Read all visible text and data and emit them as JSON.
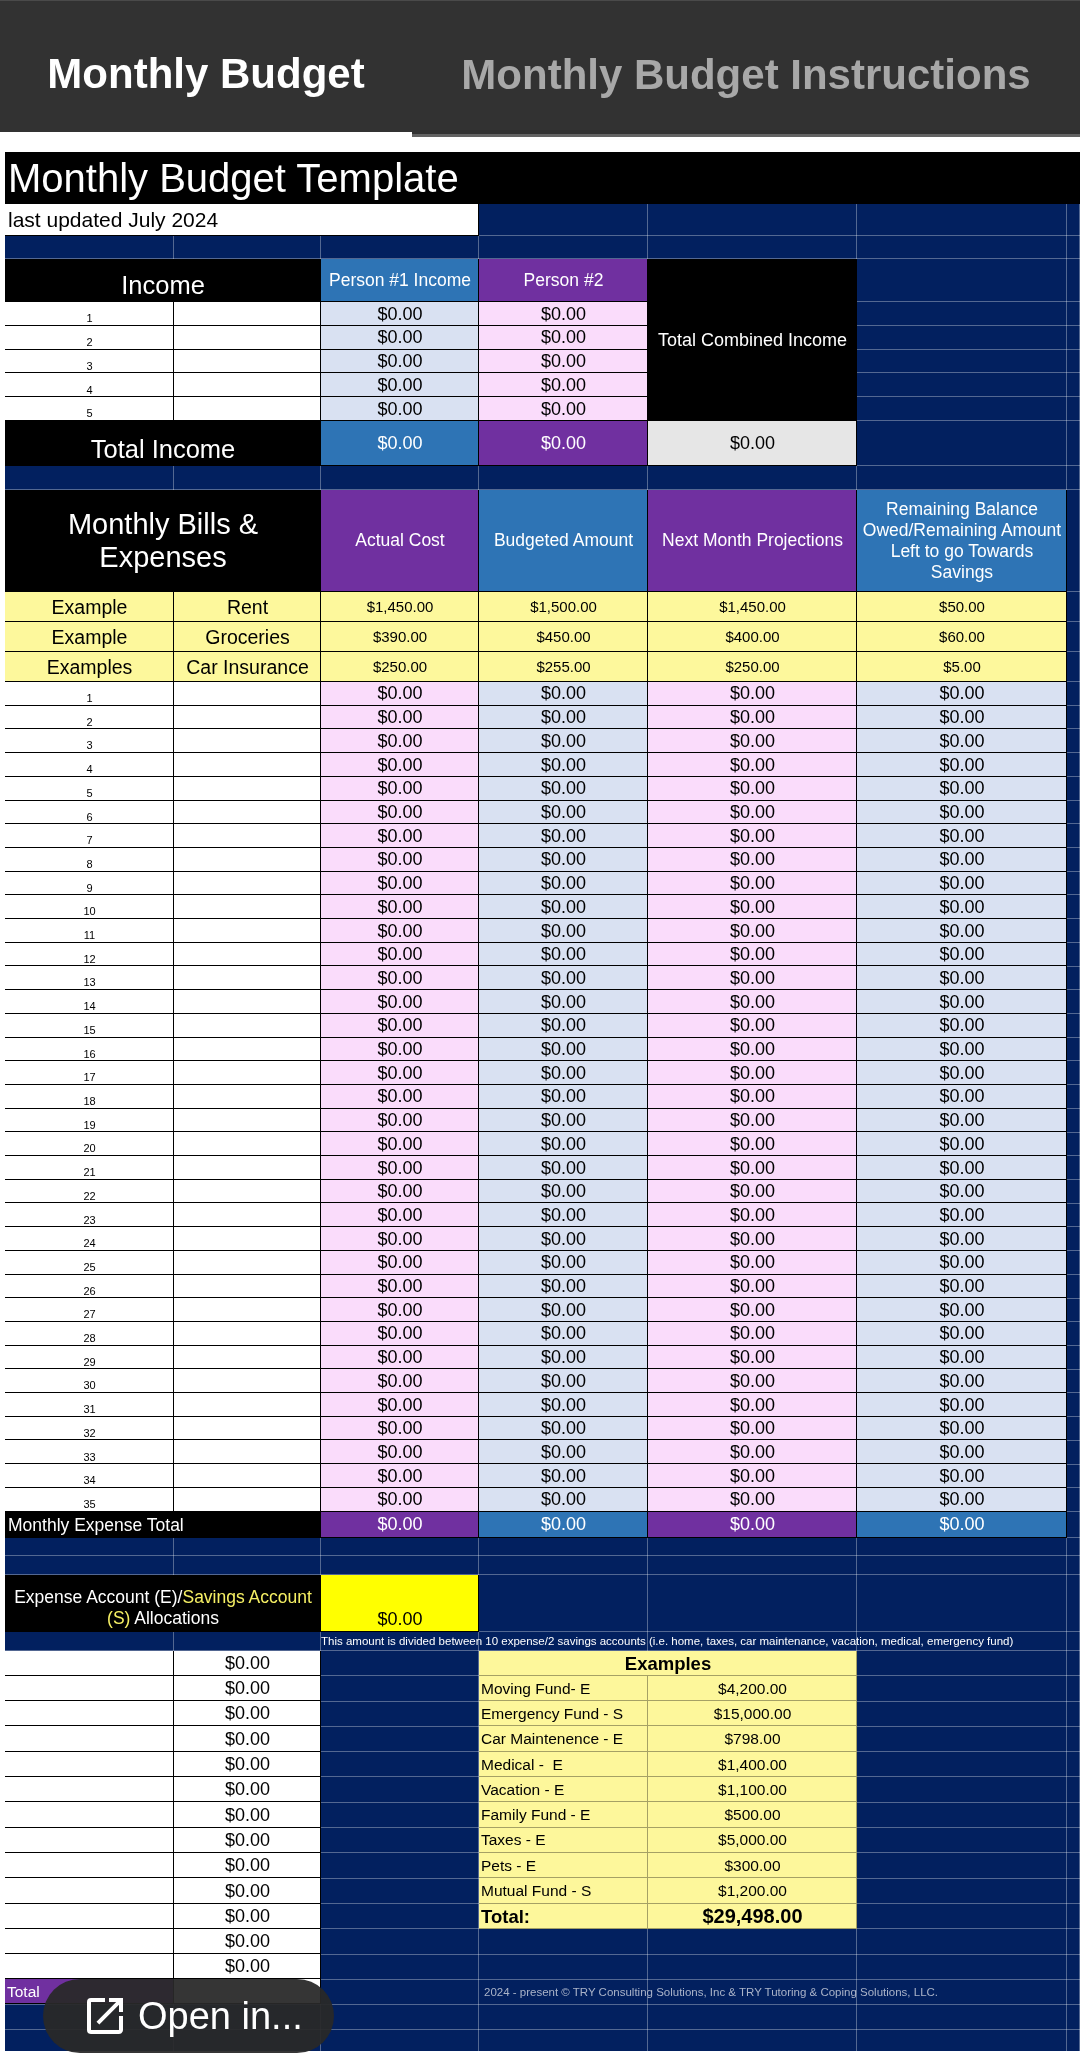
{
  "tabs": [
    {
      "label": "Monthly Budget",
      "selected": true
    },
    {
      "label": "Monthly Budget Instructions",
      "selected": false
    }
  ],
  "sheet": {
    "title": "Monthly Budget Template",
    "subtitle": "last updated July 2024",
    "income": {
      "heading": "Income",
      "columns": [
        "Person #1 Income",
        "Person #2"
      ],
      "combined_label": "Total Combined Income",
      "rows": [
        {
          "number": "1",
          "values": [
            "$0.00",
            "$0.00"
          ]
        },
        {
          "number": "2",
          "values": [
            "$0.00",
            "$0.00"
          ]
        },
        {
          "number": "3",
          "values": [
            "$0.00",
            "$0.00"
          ]
        },
        {
          "number": "4",
          "values": [
            "$0.00",
            "$0.00"
          ]
        },
        {
          "number": "5",
          "values": [
            "$0.00",
            "$0.00"
          ]
        }
      ],
      "total": {
        "label": "Total Income",
        "values": [
          "$0.00",
          "$0.00"
        ],
        "combined": "$0.00"
      }
    },
    "bills": {
      "heading": "Monthly Bills & Expenses",
      "columns": [
        "Actual Cost",
        "Budgeted Amount",
        "Next Month Projections",
        "Remaining Balance Owed/Remaining Amount Left to go Towards Savings"
      ],
      "examples": [
        {
          "label": "Example",
          "item": "Rent",
          "values": [
            "$1,450.00",
            "$1,500.00",
            "$1,450.00",
            "$50.00"
          ]
        },
        {
          "label": "Example",
          "item": "Groceries",
          "values": [
            "$390.00",
            "$450.00",
            "$400.00",
            "$60.00"
          ]
        },
        {
          "label": "Examples",
          "item": "Car Insurance",
          "values": [
            "$250.00",
            "$255.00",
            "$250.00",
            "$5.00"
          ]
        }
      ],
      "rows": [
        {
          "number": "1",
          "values": [
            "$0.00",
            "$0.00",
            "$0.00",
            "$0.00"
          ]
        },
        {
          "number": "2",
          "values": [
            "$0.00",
            "$0.00",
            "$0.00",
            "$0.00"
          ]
        },
        {
          "number": "3",
          "values": [
            "$0.00",
            "$0.00",
            "$0.00",
            "$0.00"
          ]
        },
        {
          "number": "4",
          "values": [
            "$0.00",
            "$0.00",
            "$0.00",
            "$0.00"
          ]
        },
        {
          "number": "5",
          "values": [
            "$0.00",
            "$0.00",
            "$0.00",
            "$0.00"
          ]
        },
        {
          "number": "6",
          "values": [
            "$0.00",
            "$0.00",
            "$0.00",
            "$0.00"
          ]
        },
        {
          "number": "7",
          "values": [
            "$0.00",
            "$0.00",
            "$0.00",
            "$0.00"
          ]
        },
        {
          "number": "8",
          "values": [
            "$0.00",
            "$0.00",
            "$0.00",
            "$0.00"
          ]
        },
        {
          "number": "9",
          "values": [
            "$0.00",
            "$0.00",
            "$0.00",
            "$0.00"
          ]
        },
        {
          "number": "10",
          "values": [
            "$0.00",
            "$0.00",
            "$0.00",
            "$0.00"
          ]
        },
        {
          "number": "11",
          "values": [
            "$0.00",
            "$0.00",
            "$0.00",
            "$0.00"
          ]
        },
        {
          "number": "12",
          "values": [
            "$0.00",
            "$0.00",
            "$0.00",
            "$0.00"
          ]
        },
        {
          "number": "13",
          "values": [
            "$0.00",
            "$0.00",
            "$0.00",
            "$0.00"
          ]
        },
        {
          "number": "14",
          "values": [
            "$0.00",
            "$0.00",
            "$0.00",
            "$0.00"
          ]
        },
        {
          "number": "15",
          "values": [
            "$0.00",
            "$0.00",
            "$0.00",
            "$0.00"
          ]
        },
        {
          "number": "16",
          "values": [
            "$0.00",
            "$0.00",
            "$0.00",
            "$0.00"
          ]
        },
        {
          "number": "17",
          "values": [
            "$0.00",
            "$0.00",
            "$0.00",
            "$0.00"
          ]
        },
        {
          "number": "18",
          "values": [
            "$0.00",
            "$0.00",
            "$0.00",
            "$0.00"
          ]
        },
        {
          "number": "19",
          "values": [
            "$0.00",
            "$0.00",
            "$0.00",
            "$0.00"
          ]
        },
        {
          "number": "20",
          "values": [
            "$0.00",
            "$0.00",
            "$0.00",
            "$0.00"
          ]
        },
        {
          "number": "21",
          "values": [
            "$0.00",
            "$0.00",
            "$0.00",
            "$0.00"
          ]
        },
        {
          "number": "22",
          "values": [
            "$0.00",
            "$0.00",
            "$0.00",
            "$0.00"
          ]
        },
        {
          "number": "23",
          "values": [
            "$0.00",
            "$0.00",
            "$0.00",
            "$0.00"
          ]
        },
        {
          "number": "24",
          "values": [
            "$0.00",
            "$0.00",
            "$0.00",
            "$0.00"
          ]
        },
        {
          "number": "25",
          "values": [
            "$0.00",
            "$0.00",
            "$0.00",
            "$0.00"
          ]
        },
        {
          "number": "26",
          "values": [
            "$0.00",
            "$0.00",
            "$0.00",
            "$0.00"
          ]
        },
        {
          "number": "27",
          "values": [
            "$0.00",
            "$0.00",
            "$0.00",
            "$0.00"
          ]
        },
        {
          "number": "28",
          "values": [
            "$0.00",
            "$0.00",
            "$0.00",
            "$0.00"
          ]
        },
        {
          "number": "29",
          "values": [
            "$0.00",
            "$0.00",
            "$0.00",
            "$0.00"
          ]
        },
        {
          "number": "30",
          "values": [
            "$0.00",
            "$0.00",
            "$0.00",
            "$0.00"
          ]
        },
        {
          "number": "31",
          "values": [
            "$0.00",
            "$0.00",
            "$0.00",
            "$0.00"
          ]
        },
        {
          "number": "32",
          "values": [
            "$0.00",
            "$0.00",
            "$0.00",
            "$0.00"
          ]
        },
        {
          "number": "33",
          "values": [
            "$0.00",
            "$0.00",
            "$0.00",
            "$0.00"
          ]
        },
        {
          "number": "34",
          "values": [
            "$0.00",
            "$0.00",
            "$0.00",
            "$0.00"
          ]
        },
        {
          "number": "35",
          "values": [
            "$0.00",
            "$0.00",
            "$0.00",
            "$0.00"
          ]
        }
      ],
      "total": {
        "label": "Monthly Expense Total",
        "values": [
          "$0.00",
          "$0.00",
          "$0.00",
          "$0.00"
        ]
      }
    },
    "allocations": {
      "label": [
        {
          "text": "Expense Account (E)/",
          "highlight": false
        },
        {
          "text": "Savings Account (S)",
          "highlight": true
        },
        {
          "text": " Allocations",
          "highlight": false
        }
      ],
      "amount": "$0.00",
      "note": "This amount is divided between 10 expense/2 savings accounts (i.e. home, taxes, car maintenance, vacation, medical, emergency fund)",
      "values": [
        "$0.00",
        "$0.00",
        "$0.00",
        "$0.00",
        "$0.00",
        "$0.00",
        "$0.00",
        "$0.00",
        "$0.00",
        "$0.00",
        "$0.00",
        "$0.00",
        "$0.00"
      ],
      "total": {
        "label": "Total"
      }
    },
    "examples": {
      "heading": "Examples",
      "items": [
        {
          "label": "Moving Fund- E",
          "amount": "$4,200.00"
        },
        {
          "label": "Emergency Fund - S",
          "amount": "$15,000.00"
        },
        {
          "label": "Car Maintenence - E",
          "amount": "$798.00"
        },
        {
          "label": "Medical -  E",
          "amount": "$1,400.00"
        },
        {
          "label": "Vacation - E",
          "amount": "$1,100.00"
        },
        {
          "label": "Family Fund - E",
          "amount": "$500.00"
        },
        {
          "label": "Taxes - E",
          "amount": "$5,000.00"
        },
        {
          "label": "Pets - E",
          "amount": "$300.00"
        },
        {
          "label": "Mutual Fund - S",
          "amount": "$1,200.00"
        }
      ],
      "total": {
        "label": "Total:",
        "amount": "$29,498.00"
      }
    },
    "footer": "2024 - present © TRY Consulting Solutions, Inc & TRY Tutoring & Coping Solutions, LLC."
  },
  "open_button": {
    "label": "Open in..."
  }
}
